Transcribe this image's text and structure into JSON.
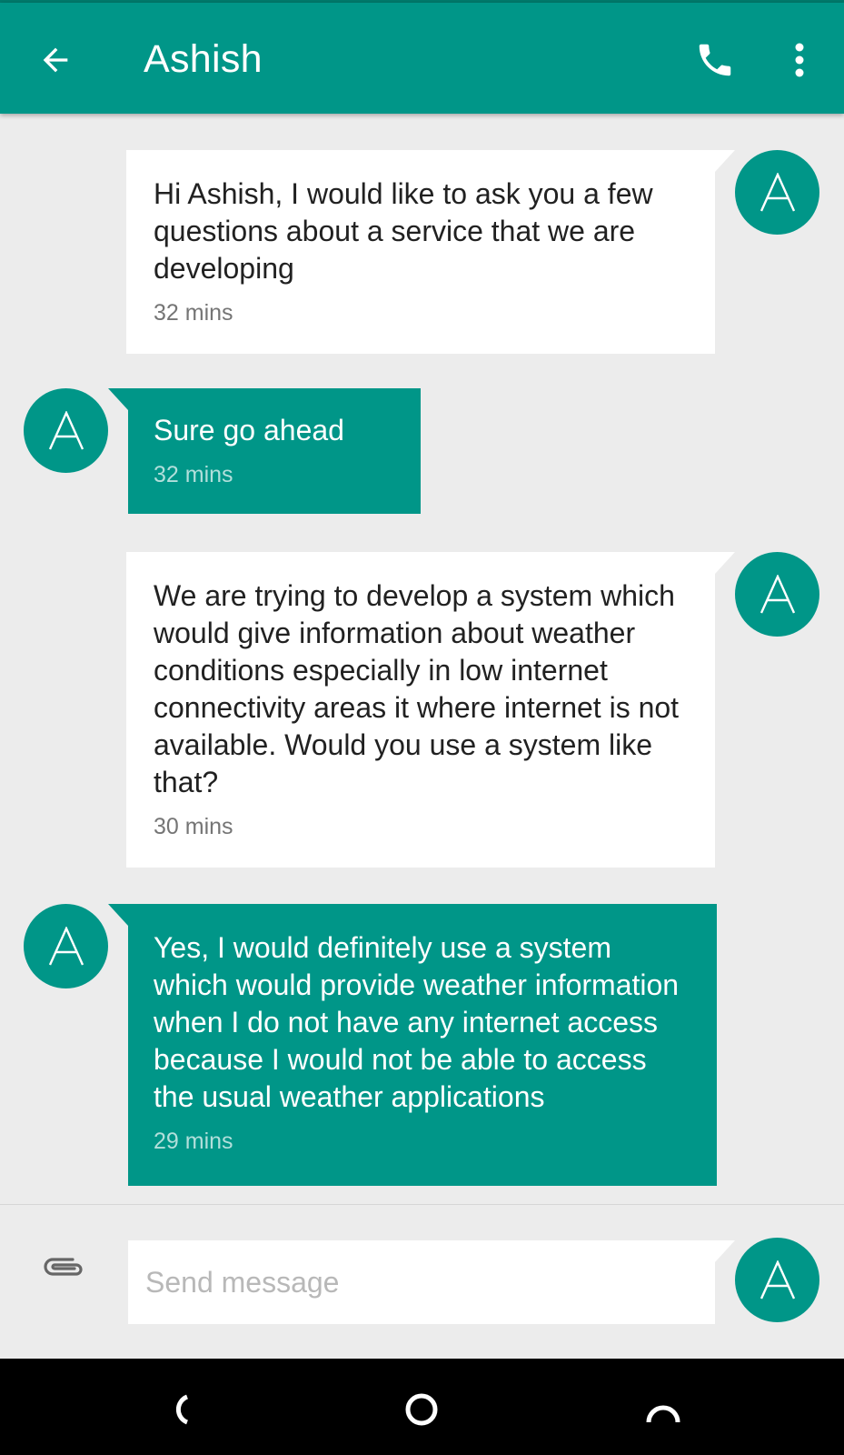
{
  "header": {
    "contact_name": "Ashish",
    "back_icon": "arrow-back-icon",
    "call_icon": "phone-icon",
    "menu_icon": "more-vert-icon"
  },
  "avatar_letter": "A",
  "messages": [
    {
      "direction": "outgoing",
      "text": "Hi Ashish, I would like to ask you a few questions about a service that we are developing",
      "time": "32 mins"
    },
    {
      "direction": "incoming",
      "text": "Sure go ahead",
      "time": "32 mins"
    },
    {
      "direction": "outgoing",
      "text": "We are trying to develop a system which would give information about weather conditions especially in low internet connectivity areas it where internet is not available. Would you use a system like that?",
      "time": "30 mins"
    },
    {
      "direction": "incoming",
      "text": "Yes, I would definitely use a system which would provide weather information when I do not have any internet access because I would not be able to access the usual weather applications",
      "time": "29 mins"
    }
  ],
  "compose": {
    "placeholder": "Send message",
    "value": "",
    "attach_icon": "paperclip-icon"
  },
  "colors": {
    "accent": "#009688",
    "accent_dark": "#00796b",
    "background": "#ececec",
    "bubble_out": "#ffffff"
  },
  "navbar": {
    "back_icon": "nav-back-icon",
    "home_icon": "nav-home-icon",
    "recents_icon": "nav-recents-icon"
  }
}
